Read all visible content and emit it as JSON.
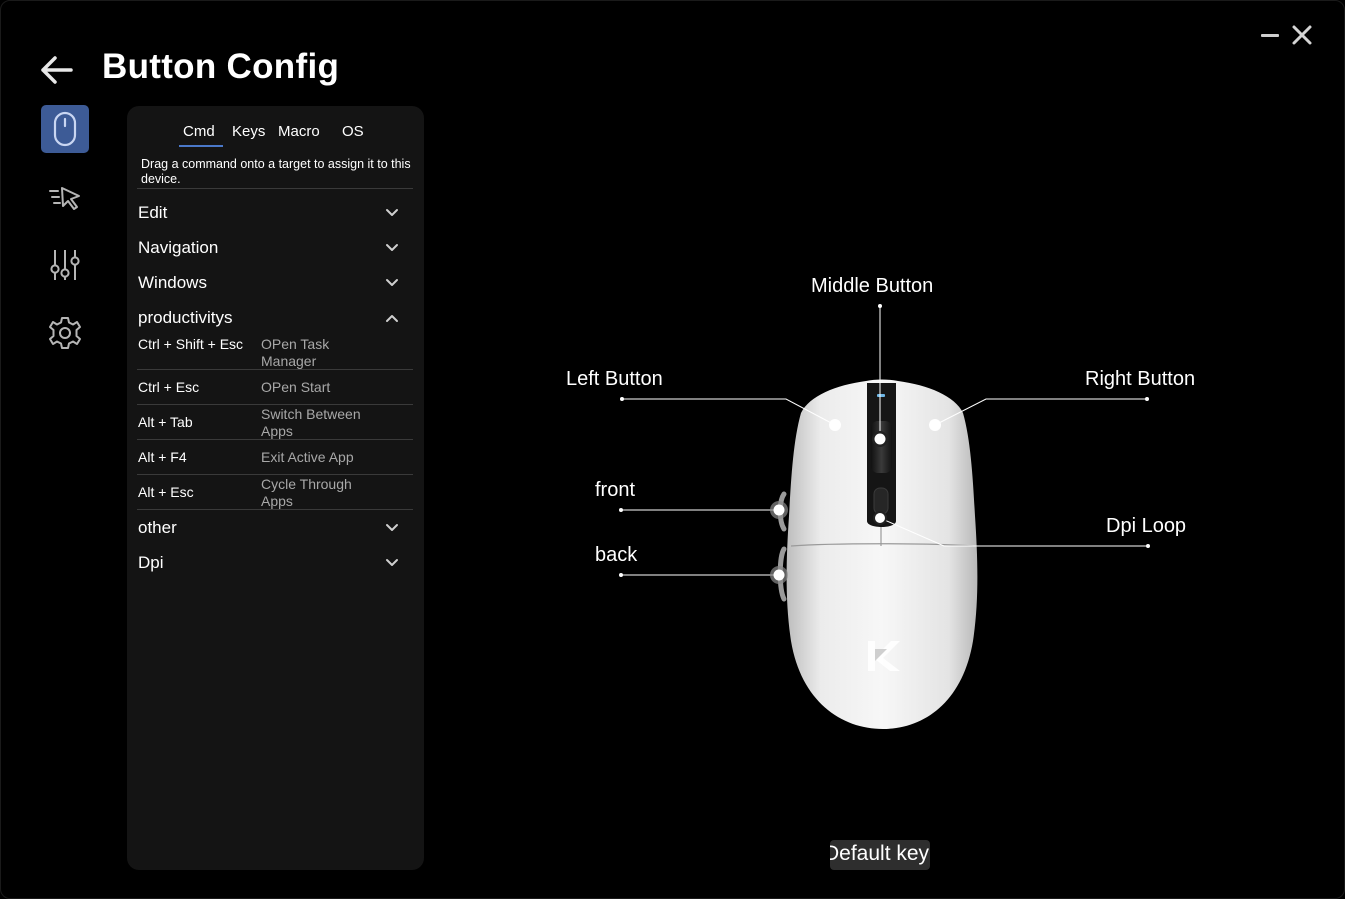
{
  "window": {
    "title": "Button Config",
    "controls": [
      "minimize-icon",
      "close-icon"
    ]
  },
  "rail": {
    "items": [
      {
        "icon": "mouse-icon",
        "active": true
      },
      {
        "icon": "pointer-speed-icon",
        "active": false
      },
      {
        "icon": "sliders-icon",
        "active": false
      },
      {
        "icon": "gear-icon",
        "active": false
      }
    ],
    "accent": "#3d5b96"
  },
  "panel": {
    "tabs": [
      "Cmd",
      "Keys",
      "Macro",
      "OS"
    ],
    "active_tab": "Cmd",
    "hint": "Drag a command onto a target to assign it to this device.",
    "categories": [
      {
        "label": "Edit",
        "expanded": false
      },
      {
        "label": "Navigation",
        "expanded": false
      },
      {
        "label": "Windows",
        "expanded": false
      },
      {
        "label": "productivitys",
        "expanded": true
      },
      {
        "label": "other",
        "expanded": false
      },
      {
        "label": "Dpi",
        "expanded": false
      }
    ],
    "commands": [
      {
        "keys": "Ctrl + Shift + Esc",
        "desc": "OPen Task Manager"
      },
      {
        "keys": "Ctrl + Esc",
        "desc": "OPen Start"
      },
      {
        "keys": "Alt  + Tab",
        "desc": "Switch Between Apps"
      },
      {
        "keys": "Alt  + F4",
        "desc": "Exit Active App"
      },
      {
        "keys": "Alt  + Esc",
        "desc": "Cycle Through Apps"
      }
    ]
  },
  "mouse": {
    "labels": {
      "middle": "Middle Button",
      "left": "Left Button",
      "right": "Right Button",
      "front": "front",
      "back": "back",
      "dpi": "Dpi Loop"
    },
    "logo": "K"
  },
  "footer": {
    "default_button": "Default key"
  }
}
